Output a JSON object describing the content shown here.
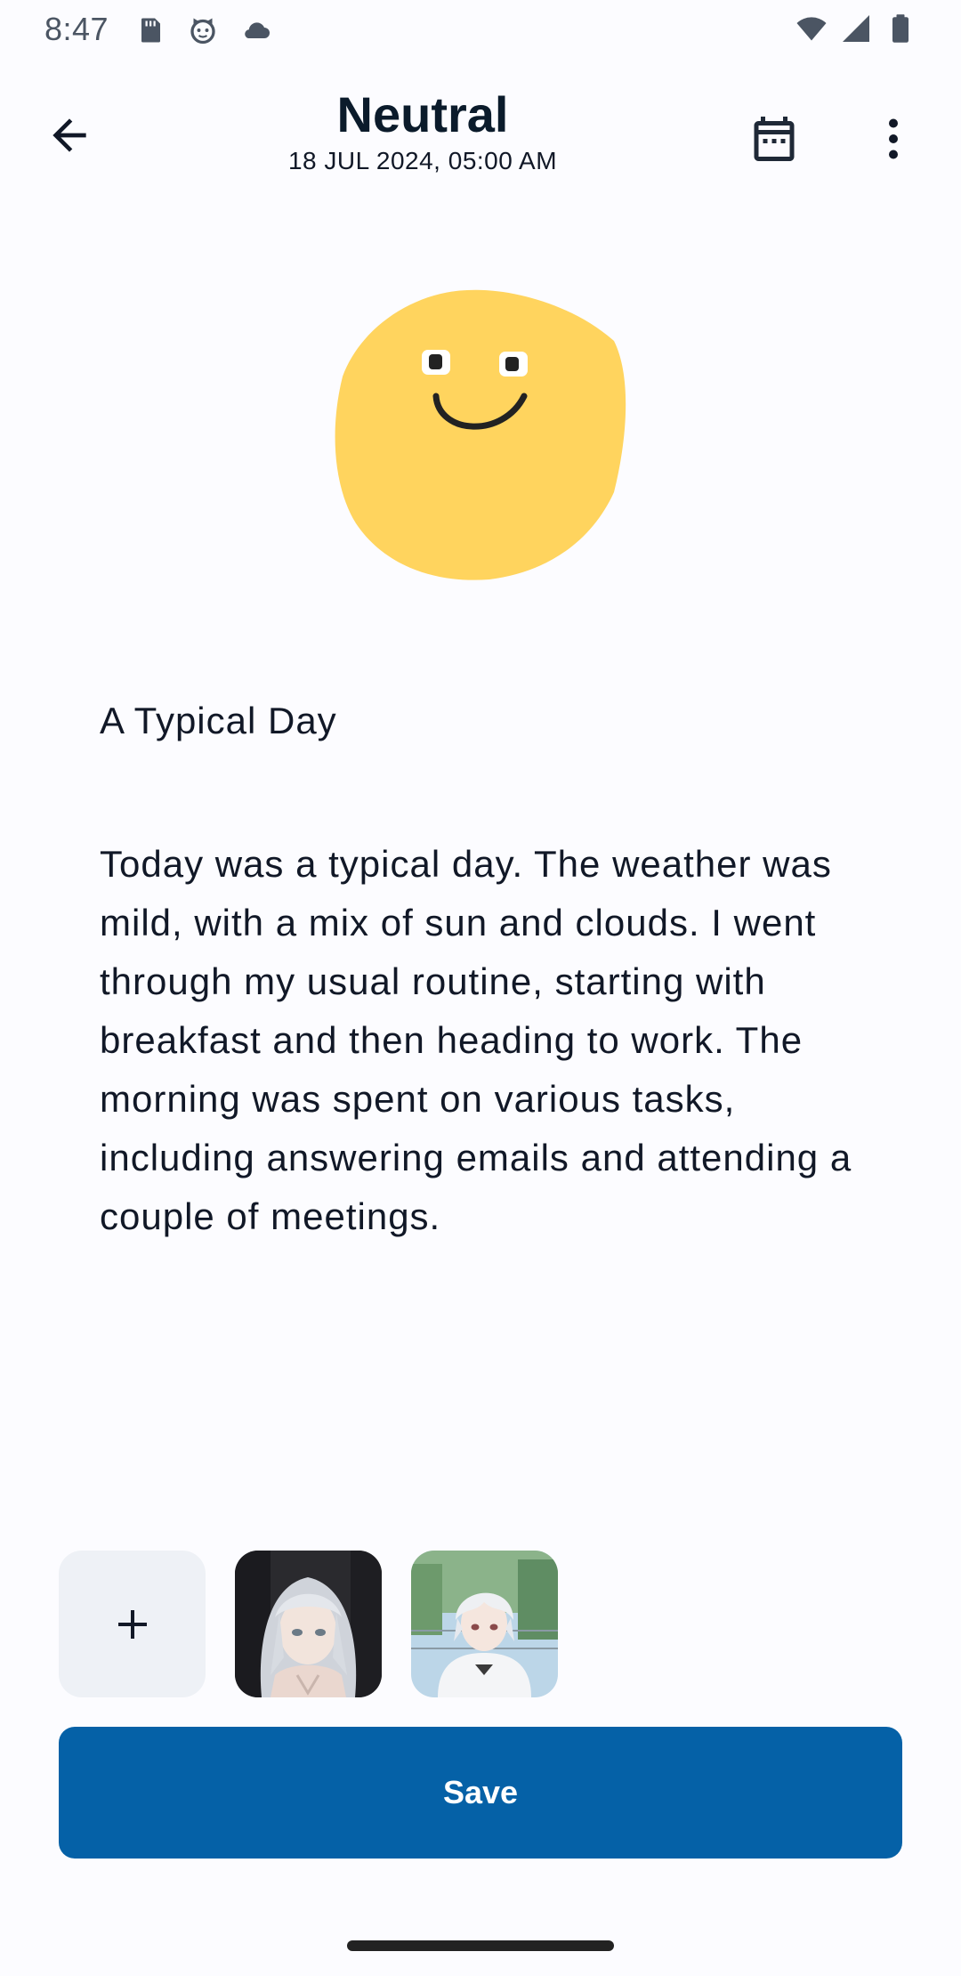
{
  "status_bar": {
    "time": "8:47"
  },
  "header": {
    "title": "Neutral",
    "datetime": "18 JUL 2024, 05:00 AM"
  },
  "entry": {
    "title": "A Typical Day",
    "body": "Today was a typical day. The weather was mild, with a mix of sun and clouds. I went through my usual routine, starting with breakfast and then heading to work. The morning was spent on various tasks, including answering emails and attending a couple of meetings."
  },
  "attachments": {
    "items": [
      {
        "type": "add",
        "icon": "plus-icon"
      },
      {
        "type": "image",
        "icon": "anime-girl-thumbnail"
      },
      {
        "type": "image",
        "icon": "anime-boy-thumbnail"
      }
    ]
  },
  "actions": {
    "save_label": "Save"
  },
  "colors": {
    "primary": "#0561a7",
    "mood_yellow": "#ffd45e",
    "background": "#fcfcff"
  }
}
